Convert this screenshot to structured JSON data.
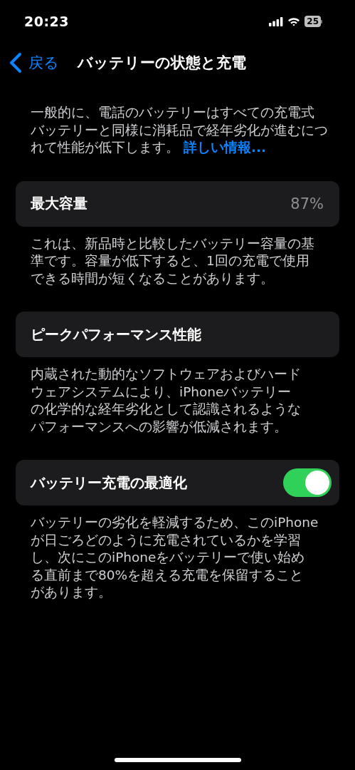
{
  "status_bar": {
    "time": "20:23",
    "battery_percent": "25"
  },
  "nav": {
    "back": "戻る",
    "title": "バッテリーの状態と充電"
  },
  "intro": {
    "lines": [
      "一般的に、電話のバッテリーはすべての充電式",
      "バッテリーと同様に消耗品で経年劣化が進むにつ",
      "れて性能が低下します。"
    ],
    "link": "詳しい情報..."
  },
  "sections": [
    {
      "kind": "value",
      "label": "最大容量",
      "value": "87%",
      "footer": [
        "これは、新品時と比較したバッテリー容量の基",
        "準です。容量が低下すると、1回の充電で使用",
        "できる時間が短くなることがあります。"
      ]
    },
    {
      "kind": "plain",
      "label": "ピークパフォーマンス性能",
      "footer": [
        "内蔵された動的なソフトウェアおよびハード",
        "ウェアシステムにより、iPhoneバッテリー",
        "の化学的な経年劣化として認識されるような",
        "パフォーマンスへの影響が低減されます。"
      ]
    },
    {
      "kind": "toggle",
      "label": "バッテリー充電の最適化",
      "on": true,
      "footer": [
        "バッテリーの劣化を軽減するため、このiPhone",
        "が日ごろどのように充電されているかを学習",
        "し、次にこのiPhoneをバッテリーで使い始め",
        "る直前まで80%を超える充電を保留すること",
        "があります。"
      ]
    }
  ]
}
